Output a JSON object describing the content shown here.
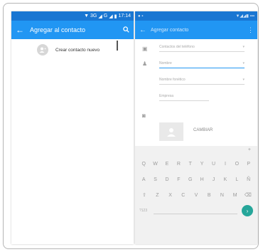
{
  "left_screen": {
    "status": {
      "network": "3G",
      "network2": "G",
      "time": "17:14"
    },
    "appbar": {
      "title": "Agregar al contacto"
    },
    "create_row": {
      "label": "Crear contacto nuevo"
    }
  },
  "right_screen": {
    "appbar": {
      "title": "Agregar contacto"
    },
    "form": {
      "account_field": "Contactos del teléfono",
      "name_field": "Nombre",
      "phonetic_field": "Nombre fonético",
      "company_field": "Empresa",
      "photo_label": "CAMBIAR"
    },
    "keyboard": {
      "row1": [
        "Q",
        "W",
        "E",
        "R",
        "T",
        "Y",
        "U",
        "I",
        "O",
        "P"
      ],
      "row2": [
        "A",
        "S",
        "D",
        "F",
        "G",
        "H",
        "J",
        "K",
        "L",
        "Ñ"
      ],
      "row3": [
        "⇧",
        "Z",
        "X",
        "C",
        "V",
        "B",
        "N",
        "M",
        "⌫"
      ],
      "sym_key": "?123"
    }
  },
  "colors": {
    "status_bar": "#1976d2",
    "app_bar": "#2196f3",
    "accent_button": "#26a69a"
  }
}
